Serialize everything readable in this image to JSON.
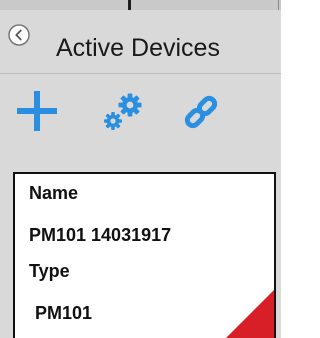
{
  "header": {
    "title": "Active Devices",
    "back_icon": "circle-chevron-left-icon"
  },
  "toolbar": {
    "items": [
      {
        "icon": "plus-icon",
        "action": "add-device"
      },
      {
        "icon": "gears-icon",
        "action": "configure-device"
      },
      {
        "icon": "link-icon",
        "action": "connect-device"
      }
    ],
    "accent_color": "#2a8fe0"
  },
  "device_card": {
    "name_label": "Name",
    "name_value": "PM101 14031917",
    "type_label": "Type",
    "type_value": "PM101",
    "corner_color": "#d61f26"
  }
}
